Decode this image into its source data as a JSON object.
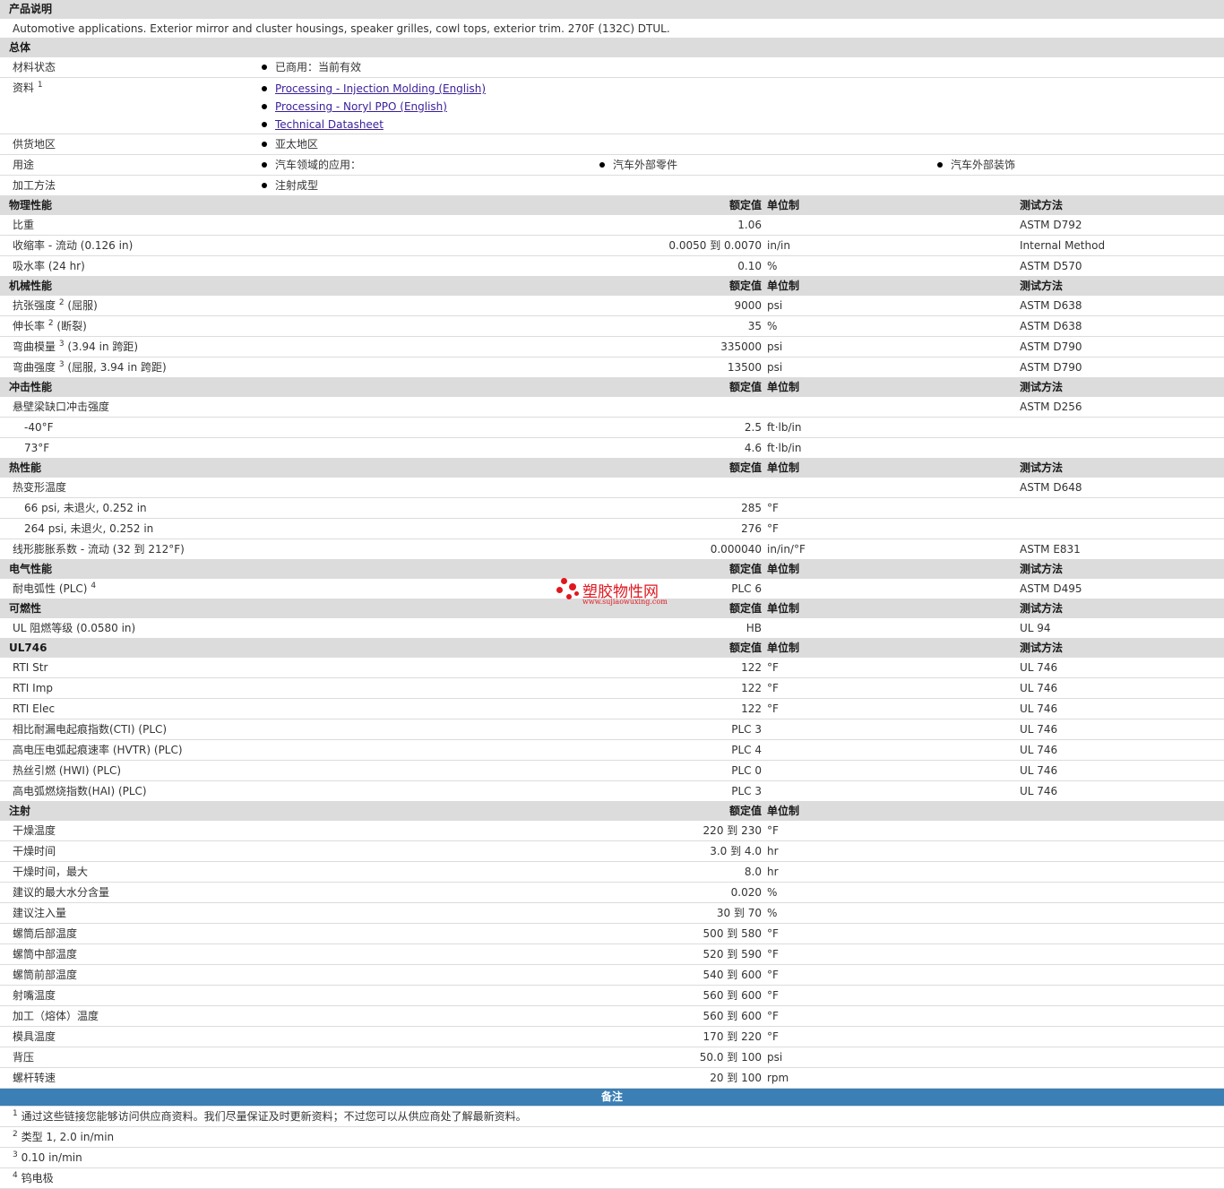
{
  "description": {
    "header": "产品说明",
    "text": "Automotive applications. Exterior mirror and cluster housings, speaker grilles, cowl tops, exterior trim. 270F (132C) DTUL."
  },
  "general": {
    "header": "总体",
    "material_status": {
      "label": "材料状态",
      "value": "已商用：当前有效"
    },
    "resources": {
      "label": "资料",
      "sup": "1",
      "links": [
        "Processing - Injection Molding (English)",
        "Processing - Noryl PPO (English)",
        "Technical Datasheet"
      ]
    },
    "availability": {
      "label": "供货地区",
      "value": "亚太地区"
    },
    "uses": {
      "label": "用途",
      "values": [
        "汽车领域的应用：",
        "汽车外部零件",
        "汽车外部装饰"
      ]
    },
    "processing_method": {
      "label": "加工方法",
      "value": "注射成型"
    }
  },
  "col_headers": {
    "nominal": "额定值",
    "units": "单位制",
    "test": "测试方法"
  },
  "physical": {
    "header": "物理性能",
    "rows": [
      {
        "name": "比重",
        "value": "1.06",
        "unit": "",
        "test": "ASTM D792"
      },
      {
        "name": "收缩率 - 流动 (0.126 in)",
        "value": "0.0050 到 0.0070",
        "unit": "in/in",
        "test": "Internal Method"
      },
      {
        "name": "吸水率 (24 hr)",
        "value": "0.10",
        "unit": "%",
        "test": "ASTM D570"
      }
    ]
  },
  "mechanical": {
    "header": "机械性能",
    "rows": [
      {
        "name": "抗张强度",
        "sup": "2",
        "suffix": "(屈服)",
        "value": "9000",
        "unit": "psi",
        "test": "ASTM D638"
      },
      {
        "name": "伸长率",
        "sup": "2",
        "suffix": "(断裂)",
        "value": "35",
        "unit": "%",
        "test": "ASTM D638"
      },
      {
        "name": "弯曲模量",
        "sup": "3",
        "suffix": "(3.94 in 跨距)",
        "value": "335000",
        "unit": "psi",
        "test": "ASTM D790"
      },
      {
        "name": "弯曲强度",
        "sup": "3",
        "suffix": "(屈服, 3.94 in 跨距)",
        "value": "13500",
        "unit": "psi",
        "test": "ASTM D790"
      }
    ]
  },
  "impact": {
    "header": "冲击性能",
    "group": {
      "name": "悬壁梁缺口冲击强度",
      "test": "ASTM D256"
    },
    "rows": [
      {
        "name": "-40°F",
        "value": "2.5",
        "unit": "ft·lb/in"
      },
      {
        "name": "73°F",
        "value": "4.6",
        "unit": "ft·lb/in"
      }
    ]
  },
  "thermal": {
    "header": "热性能",
    "group": {
      "name": "热变形温度",
      "test": "ASTM D648"
    },
    "rows": [
      {
        "name": "66 psi, 未退火, 0.252 in",
        "value": "285",
        "unit": "°F"
      },
      {
        "name": "264 psi, 未退火, 0.252 in",
        "value": "276",
        "unit": "°F"
      }
    ],
    "clte": {
      "name": "线形膨胀系数 - 流动 (32 到 212°F)",
      "value": "0.000040",
      "unit": "in/in/°F",
      "test": "ASTM E831"
    }
  },
  "electrical": {
    "header": "电气性能",
    "rows": [
      {
        "name": "耐电弧性 (PLC)",
        "sup": "4",
        "value": "PLC 6",
        "unit": "",
        "test": "ASTM D495"
      }
    ]
  },
  "flammability": {
    "header": "可燃性",
    "rows": [
      {
        "name": "UL 阻燃等级 (0.0580 in)",
        "value": "HB",
        "unit": "",
        "test": "UL 94"
      }
    ]
  },
  "ul746": {
    "header": "UL746",
    "rows": [
      {
        "name": "RTI Str",
        "value": "122",
        "unit": "°F",
        "test": "UL 746"
      },
      {
        "name": "RTI Imp",
        "value": "122",
        "unit": "°F",
        "test": "UL 746"
      },
      {
        "name": "RTI Elec",
        "value": "122",
        "unit": "°F",
        "test": "UL 746"
      },
      {
        "name": "相比耐漏电起痕指数(CTI) (PLC)",
        "value": "PLC 3",
        "unit": "",
        "test": "UL 746"
      },
      {
        "name": "高电压电弧起痕速率 (HVTR) (PLC)",
        "value": "PLC 4",
        "unit": "",
        "test": "UL 746"
      },
      {
        "name": "热丝引燃 (HWI) (PLC)",
        "value": "PLC 0",
        "unit": "",
        "test": "UL 746"
      },
      {
        "name": "高电弧燃烧指数(HAI) (PLC)",
        "value": "PLC 3",
        "unit": "",
        "test": "UL 746"
      }
    ]
  },
  "injection": {
    "header": "注射",
    "rows": [
      {
        "name": "干燥温度",
        "value": "220 到 230",
        "unit": "°F"
      },
      {
        "name": "干燥时间",
        "value": "3.0 到 4.0",
        "unit": "hr"
      },
      {
        "name": "干燥时间，最大",
        "value": "8.0",
        "unit": "hr"
      },
      {
        "name": "建议的最大水分含量",
        "value": "0.020",
        "unit": "%"
      },
      {
        "name": "建议注入量",
        "value": "30 到 70",
        "unit": "%"
      },
      {
        "name": "螺筒后部温度",
        "value": "500 到 580",
        "unit": "°F"
      },
      {
        "name": "螺筒中部温度",
        "value": "520 到 590",
        "unit": "°F"
      },
      {
        "name": "螺筒前部温度",
        "value": "540 到 600",
        "unit": "°F"
      },
      {
        "name": "射嘴温度",
        "value": "560 到 600",
        "unit": "°F"
      },
      {
        "name": "加工（熔体）温度",
        "value": "560 到 600",
        "unit": "°F"
      },
      {
        "name": "模具温度",
        "value": "170 到 220",
        "unit": "°F"
      },
      {
        "name": "背压",
        "value": "50.0 到 100",
        "unit": "psi"
      },
      {
        "name": "螺杆转速",
        "value": "20 到 100",
        "unit": "rpm"
      }
    ]
  },
  "notes": {
    "header": "备注",
    "rows": [
      {
        "sup": "1",
        "text": "通过这些链接您能够访问供应商资料。我们尽量保证及时更新资料；不过您可以从供应商处了解最新资料。"
      },
      {
        "sup": "2",
        "text": "类型 1, 2.0 in/min"
      },
      {
        "sup": "3",
        "text": "0.10 in/min"
      },
      {
        "sup": "4",
        "text": "钨电极"
      }
    ]
  },
  "watermark": {
    "name": "塑胶物性网",
    "url": "www.sujiaowuxing.com",
    "color": "#e0171e"
  }
}
